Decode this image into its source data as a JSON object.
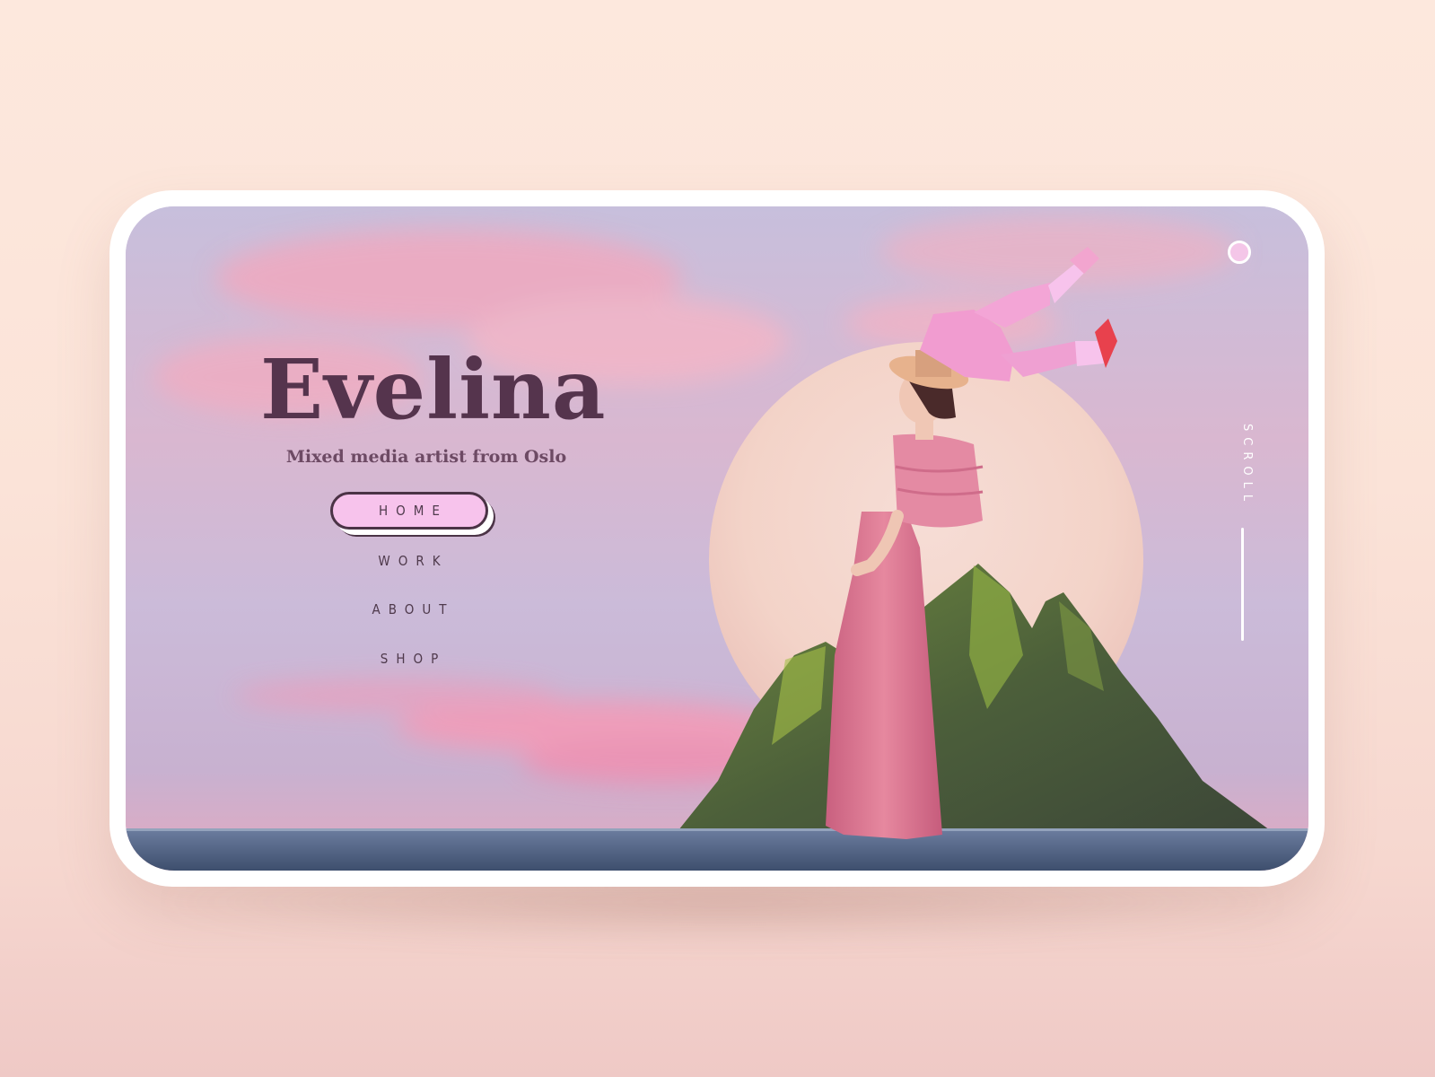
{
  "hero": {
    "title": "Evelina",
    "subtitle": "Mixed media artist from Oslo"
  },
  "nav": {
    "items": [
      {
        "label": "HOME",
        "active": true
      },
      {
        "label": "WORK",
        "active": false
      },
      {
        "label": "ABOUT",
        "active": false
      },
      {
        "label": "SHOP",
        "active": false
      }
    ]
  },
  "scroll": {
    "label": "SCROLL"
  },
  "icons": {
    "top_right_dot": "circle-dot-icon"
  },
  "colors": {
    "title": "#55344d",
    "active_nav_fill": "#f7c3ec",
    "page_background": "#fbe3d8",
    "accent_pink": "#e585ab"
  }
}
